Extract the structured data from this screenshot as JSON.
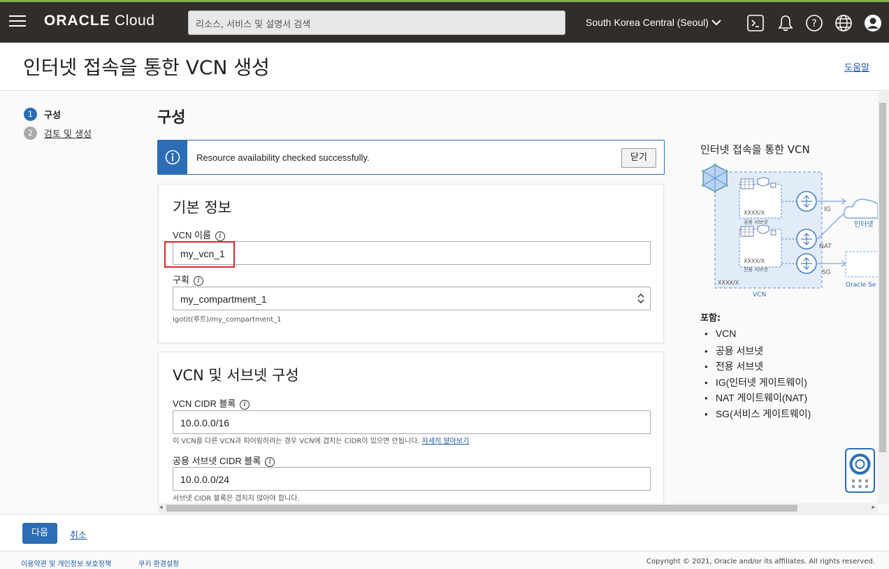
{
  "header": {
    "brand_bold": "ORACLE",
    "brand_rest": " Cloud",
    "search_placeholder": "리소스, 서비스 및 설명서 검색",
    "region": "South Korea Central (Seoul)"
  },
  "page": {
    "title": "인터넷 접속을 통한 VCN 생성",
    "help": "도움말"
  },
  "steps": [
    {
      "num": "1",
      "label": "구성"
    },
    {
      "num": "2",
      "label": "검토 및 생성"
    }
  ],
  "main": {
    "section_heading": "구성",
    "alert": {
      "text": "Resource availability checked successfully.",
      "close": "닫기"
    },
    "basic_info": {
      "title": "기본 정보",
      "vcn_name_label": "VCN 이름",
      "vcn_name_value": "my_vcn_1",
      "compartment_label": "구획",
      "compartment_value": "my_compartment_1",
      "compartment_path": "igotit(루트)/my_compartment_1"
    },
    "vcn_subnet": {
      "title": "VCN 및 서브넷 구성",
      "cidr_label": "VCN CIDR 블록",
      "cidr_value": "10.0.0.0/16",
      "cidr_hint": "이 VCN을 다른 VCN과 피어링하려는 경우 VCN에 겹치는 CIDR이 있으면 안됩니다.",
      "cidr_hint_link": "자세히 알아보기",
      "public_subnet_label": "공용 서브넷 CIDR 블록",
      "public_subnet_value": "10.0.0.0/24",
      "public_subnet_hint": "서브넷 CIDR 블록은 겹치지 않아야 합니다."
    }
  },
  "right_panel": {
    "title": "인터넷 접속을 통한 VCN",
    "diagram_labels": {
      "public_subnet": "공용 서브넷",
      "private_subnet": "전용 서브넷",
      "cidr1": "XXXX/X",
      "cidr2": "XXXX/X",
      "vcn_cidr": "XXXX/X",
      "vcn": "VCN",
      "ig": "IG",
      "nat": "NAT",
      "sg": "SG",
      "internet": "인터넷",
      "oracle_services": "Oracle Se"
    },
    "includes_title": "포함:",
    "includes": [
      "VCN",
      "공용 서브넷",
      "전용 서브넷",
      "IG(인터넷 게이트웨이)",
      "NAT 게이트웨이(NAT)",
      "SG(서비스 게이트웨이)"
    ]
  },
  "actions": {
    "next": "다음",
    "cancel": "취소"
  },
  "footer": {
    "terms": "이용약관 및 개인정보 보호정책",
    "cookies": "쿠키 환경설정",
    "copyright": "Copyright © 2021, Oracle and/or its affiliates. All rights reserved."
  },
  "colors": {
    "nav_bg": "#312d2a",
    "accent": "#2c6db5",
    "highlight": "#d52b2b"
  }
}
